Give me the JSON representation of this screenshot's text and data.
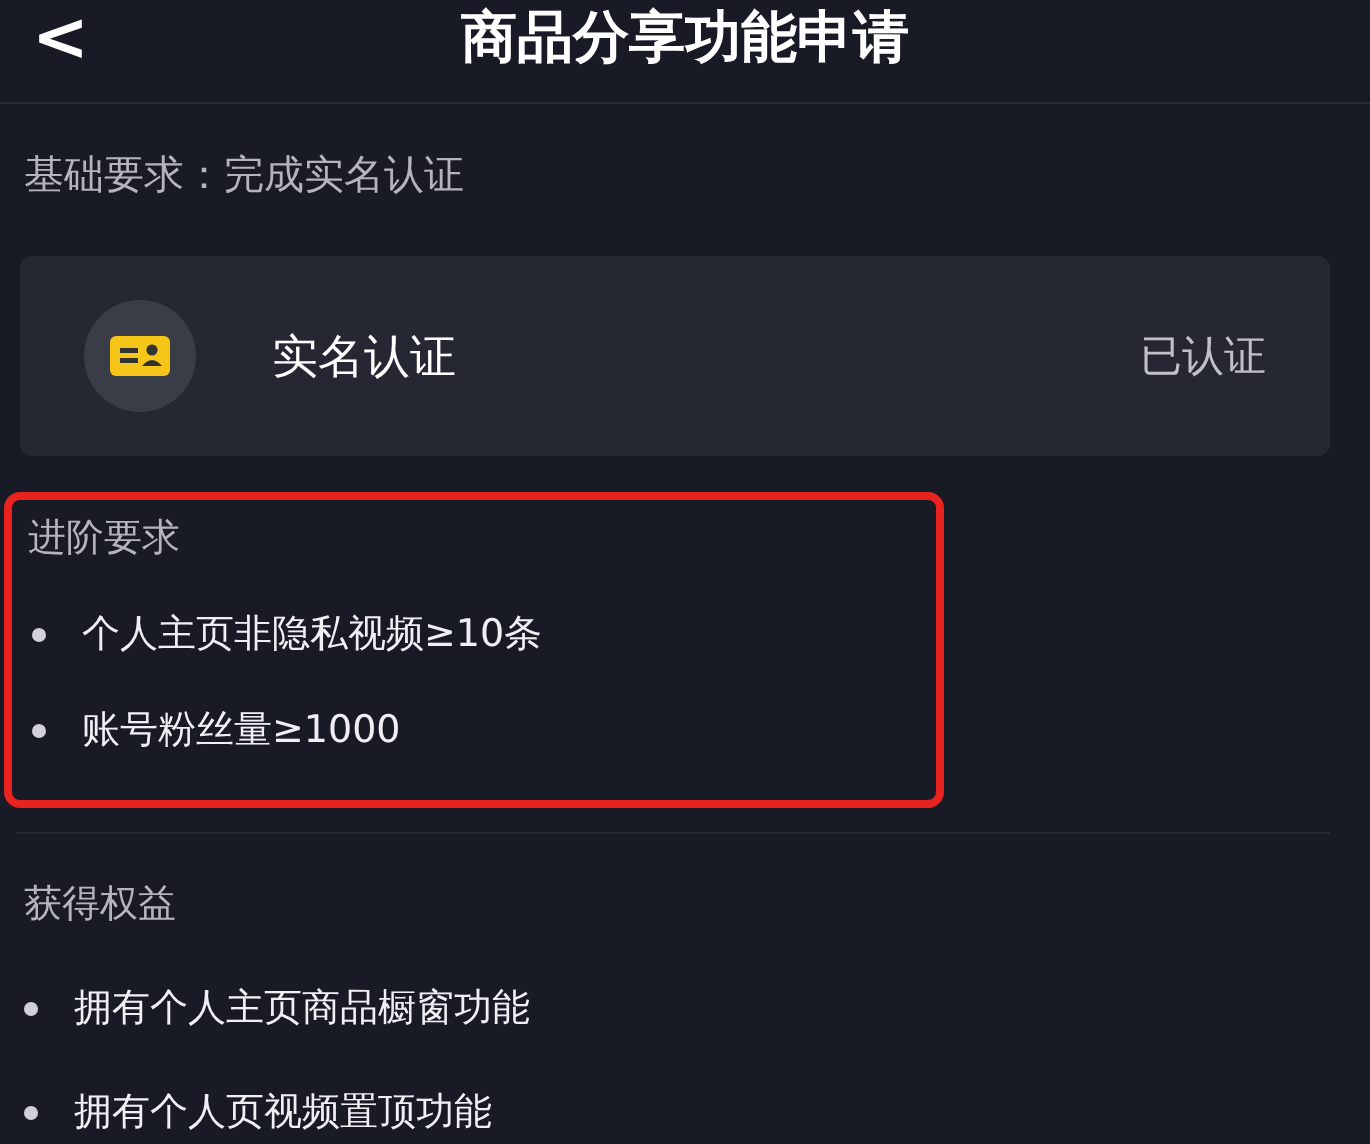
{
  "header": {
    "back": "<",
    "title": "商品分享功能申请"
  },
  "basic_requirement": "基础要求：完成实名认证",
  "verification_card": {
    "label": "实名认证",
    "status": "已认证"
  },
  "advanced": {
    "heading": "进阶要求",
    "highlighted": true,
    "items": [
      "个人主页非隐私视频≥10条",
      "账号粉丝量≥1000"
    ]
  },
  "benefits": {
    "heading": "获得权益",
    "items": [
      "拥有个人主页商品橱窗功能",
      "拥有个人页视频置顶功能"
    ]
  }
}
